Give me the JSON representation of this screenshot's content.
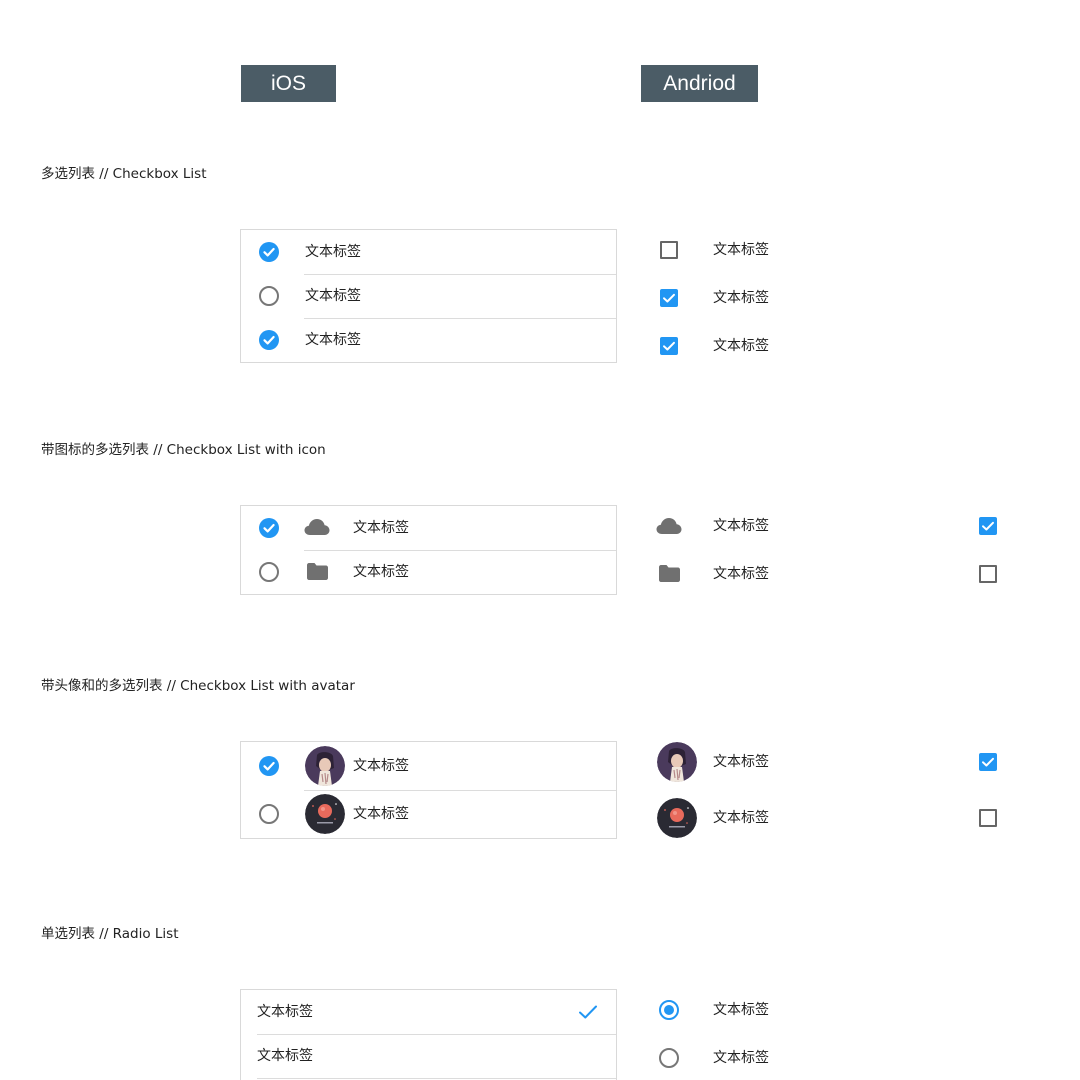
{
  "platforms": {
    "ios": "iOS",
    "android": "Andriod"
  },
  "sections": {
    "checkbox_list": {
      "title": "多选列表 // Checkbox List",
      "ios_items": [
        {
          "label": "文本标签",
          "checked": true
        },
        {
          "label": "文本标签",
          "checked": false
        },
        {
          "label": "文本标签",
          "checked": true
        }
      ],
      "android_items": [
        {
          "label": "文本标签",
          "checked": false
        },
        {
          "label": "文本标签",
          "checked": true
        },
        {
          "label": "文本标签",
          "checked": true
        }
      ]
    },
    "checkbox_icon": {
      "title": "带图标的多选列表 // Checkbox List with icon",
      "ios_items": [
        {
          "label": "文本标签",
          "checked": true,
          "icon": "cloud-icon"
        },
        {
          "label": "文本标签",
          "checked": false,
          "icon": "folder-icon"
        }
      ],
      "android_items": [
        {
          "label": "文本标签",
          "checked": true,
          "icon": "cloud-icon"
        },
        {
          "label": "文本标签",
          "checked": false,
          "icon": "folder-icon"
        }
      ]
    },
    "checkbox_avatar": {
      "title": "带头像和的多选列表 // Checkbox List with avatar",
      "ios_items": [
        {
          "label": "文本标签",
          "checked": true,
          "avatar": "portrait-avatar"
        },
        {
          "label": "文本标签",
          "checked": false,
          "avatar": "planet-avatar"
        }
      ],
      "android_items": [
        {
          "label": "文本标签",
          "checked": true,
          "avatar": "portrait-avatar"
        },
        {
          "label": "文本标签",
          "checked": false,
          "avatar": "planet-avatar"
        }
      ]
    },
    "radio_list": {
      "title": "单选列表 // Radio List",
      "ios_items": [
        {
          "label": "文本标签",
          "selected": true
        },
        {
          "label": "文本标签",
          "selected": false
        }
      ],
      "android_items": [
        {
          "label": "文本标签",
          "selected": true
        },
        {
          "label": "文本标签",
          "selected": false
        }
      ]
    }
  },
  "colors": {
    "accent": "#2196f3",
    "tag_bg": "#4b5c66",
    "icon_gray": "#707070",
    "border": "#d9d9d9"
  }
}
